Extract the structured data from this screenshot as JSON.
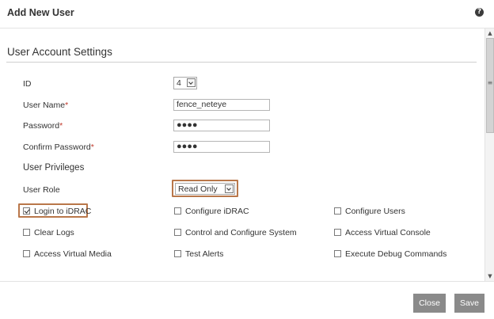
{
  "dialog": {
    "title": "Add New User",
    "help_icon": "question-circle-icon"
  },
  "section": {
    "title": "User Account Settings"
  },
  "form": {
    "id": {
      "label": "ID",
      "value": "4"
    },
    "user_name": {
      "label": "User Name",
      "required": "*",
      "value": "fence_neteye"
    },
    "password": {
      "label": "Password",
      "required": "*",
      "value": "●●●●"
    },
    "confirm_password": {
      "label": "Confirm Password",
      "required": "*",
      "value": "●●●●"
    }
  },
  "privileges": {
    "title": "User Privileges",
    "role_label": "User Role",
    "role_value": "Read Only",
    "items": [
      {
        "label": "Login to iDRAC",
        "checked": true
      },
      {
        "label": "Configure iDRAC",
        "checked": false
      },
      {
        "label": "Configure Users",
        "checked": false
      },
      {
        "label": "Clear Logs",
        "checked": false
      },
      {
        "label": "Control and Configure System",
        "checked": false
      },
      {
        "label": "Access Virtual Console",
        "checked": false
      },
      {
        "label": "Access Virtual Media",
        "checked": false
      },
      {
        "label": "Test Alerts",
        "checked": false
      },
      {
        "label": "Execute Debug Commands",
        "checked": false
      }
    ]
  },
  "scrollbar": {
    "up_icon": "▲",
    "down_icon": "▼",
    "grip_icon": "≡"
  },
  "footer": {
    "close_label": "Close",
    "save_label": "Save"
  },
  "colors": {
    "highlight_border": "#b9774a",
    "button_bg": "#8a8a8a",
    "required": "#c0392b"
  }
}
